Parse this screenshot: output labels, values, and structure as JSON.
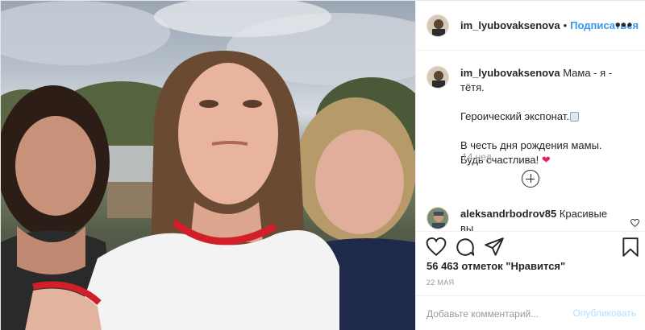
{
  "post": {
    "username": "im_lyubovaksenova",
    "dot": "•",
    "follow_label": "Подписаться",
    "more_label": "•••"
  },
  "caption": {
    "username": "im_lyubovaksenova",
    "line1": "Мама - я - тётя.",
    "line2": "Героический экспонат.",
    "line3": "В честь дня рождения мамы.",
    "line4": "Будь счастлива!",
    "heart_emoji": "❤",
    "time": "14 нед."
  },
  "comment": {
    "username": "aleksandrbodrov85",
    "text": "Красивые вы"
  },
  "actions": {
    "likes": "56 463 отметок \"Нравится\"",
    "date": "22 мая",
    "add_comment_placeholder": "Добавьте комментарий...",
    "publish_label": "Опубликовать"
  },
  "icons": {
    "like": "heart-icon",
    "comment": "comment-icon",
    "share": "share-icon",
    "save": "bookmark-icon",
    "load_more": "plus-circle-icon"
  },
  "colors": {
    "link_blue": "#3897f0",
    "muted": "#999999",
    "border": "#efefef",
    "publish_disabled": "#b2dffc"
  }
}
